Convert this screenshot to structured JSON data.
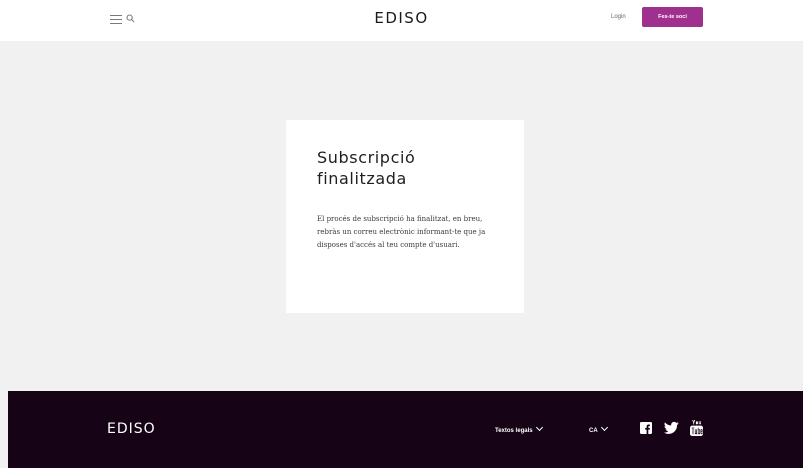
{
  "header": {
    "brand": "EDISO",
    "menu_icon": "hamburger-menu-icon",
    "search_icon": "search-icon",
    "login_label": "Login",
    "join_label": "Fes-te soci",
    "accent_color": "#a0308e"
  },
  "card": {
    "title": "Subscripció finalitzada",
    "message": "El procés de subscripció ha finalitzat, en breu, rebràs un correu electrònic informant-te que ja disposes d'accés al teu compte d'usuari."
  },
  "footer": {
    "brand": "EDISO",
    "legal_label": "Textos legals",
    "language_label": "CA",
    "background_color": "#170316",
    "social": [
      "facebook-icon",
      "twitter-icon",
      "youtube-icon"
    ]
  }
}
